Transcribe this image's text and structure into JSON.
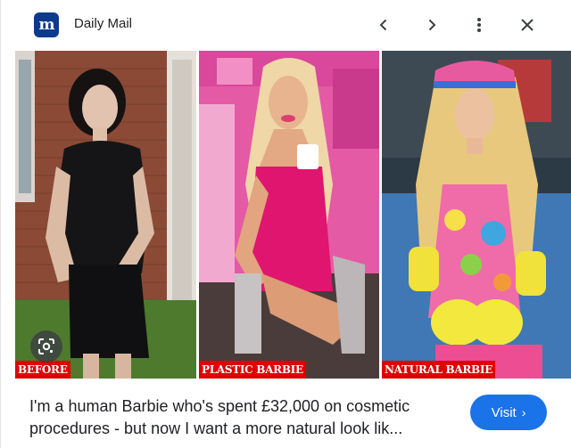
{
  "header": {
    "source_logo_text": "m",
    "source_name": "Daily Mail",
    "icons": [
      "chevron-left-icon",
      "chevron-right-icon",
      "more-vert-icon",
      "close-icon"
    ]
  },
  "images": [
    {
      "caption": "BEFORE"
    },
    {
      "caption": "PLASTIC BARBIE"
    },
    {
      "caption": "NATURAL BARBIE"
    }
  ],
  "lens": {
    "icon": "google-lens-icon"
  },
  "result": {
    "title": "I'm a human Barbie who's spent £32,000 on cosmetic procedures - but now I want a more natural look lik...",
    "visit_label": "Visit",
    "visit_chevron": "›"
  },
  "colors": {
    "accent": "#1a73e8",
    "caption_bg": "#e00000",
    "logo_bg": "#0d3b8c"
  }
}
